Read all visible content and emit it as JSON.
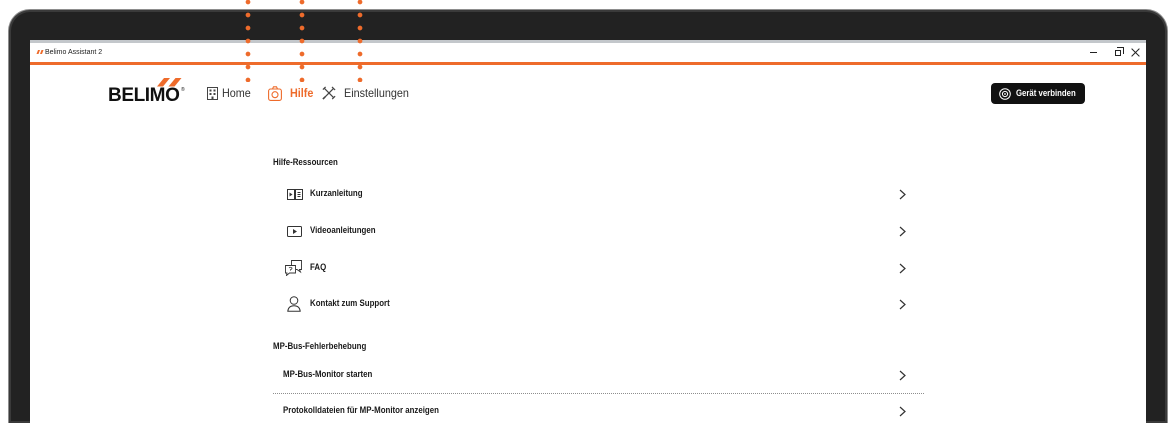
{
  "window": {
    "title": "Belimo Assistant 2",
    "app_icon": "belimo-mark-icon",
    "controls": [
      "minimize-icon",
      "maximize-icon",
      "close-icon"
    ]
  },
  "header": {
    "logo": {
      "text": "BELIMO",
      "mark": "®"
    },
    "nav": [
      {
        "label": "Home",
        "icon": "building-icon",
        "active": false
      },
      {
        "label": "Hilfe",
        "icon": "help-icon",
        "active": true
      },
      {
        "label": "Einstellungen",
        "icon": "tools-icon",
        "active": false
      }
    ],
    "connect_button": {
      "label": "Gerät verbinden",
      "icon": "connect-icon"
    }
  },
  "sections": [
    {
      "heading": "Hilfe-Ressourcen",
      "items": [
        {
          "label": "Kurzanleitung",
          "icon": "quick-guide-icon"
        },
        {
          "label": "Videoanleitungen",
          "icon": "video-icon"
        },
        {
          "label": "FAQ",
          "icon": "faq-icon"
        },
        {
          "label": "Kontakt zum Support",
          "icon": "person-icon"
        }
      ]
    },
    {
      "heading": "MP-Bus-Fehlerbehebung",
      "items": [
        {
          "label": "MP-Bus-Monitor starten"
        },
        {
          "label": "Protokolldateien für MP-Monitor anzeigen"
        }
      ]
    }
  ],
  "colors": {
    "accent": "#ee6b2b",
    "text": "#1c1c1c",
    "button_background": "#111111",
    "bezel": "#222222"
  }
}
